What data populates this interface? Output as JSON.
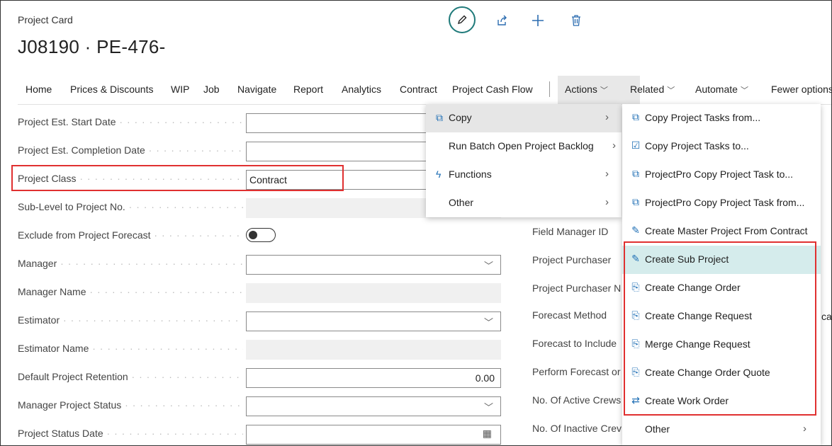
{
  "header": {
    "caption": "Project Card",
    "title": "J08190 · PE-476-"
  },
  "top_actions": [
    "edit-icon",
    "share-icon",
    "add-icon",
    "delete-icon"
  ],
  "nav": {
    "items": [
      "Home",
      "Prices & Discounts",
      "WIP",
      "Job",
      "Navigate",
      "Report",
      "Analytics",
      "Contract",
      "Project Cash Flow"
    ],
    "actions": "Actions",
    "related": "Related",
    "automate": "Automate",
    "fewer": "Fewer options"
  },
  "fields": [
    {
      "label": "Project Est. Start Date",
      "value": ""
    },
    {
      "label": "Project Est. Completion Date",
      "value": ""
    },
    {
      "label": "Project Class",
      "value": "Contract"
    },
    {
      "label": "Sub-Level to Project No.",
      "value": ""
    },
    {
      "label": "Exclude from Project Forecast",
      "value": ""
    },
    {
      "label": "Manager",
      "value": ""
    },
    {
      "label": "Manager Name",
      "value": ""
    },
    {
      "label": "Estimator",
      "value": ""
    },
    {
      "label": "Estimator Name",
      "value": ""
    },
    {
      "label": "Default Project Retention",
      "value": "0.00"
    },
    {
      "label": "Manager Project Status",
      "value": ""
    },
    {
      "label": "Project Status Date",
      "value": ""
    }
  ],
  "right_labels": [
    "Field Manager ID",
    "Project Purchaser",
    "Project Purchaser N",
    "Forecast Method",
    "Forecast to Include",
    "Perform Forecast or",
    "No. Of Active Crews",
    "No. Of Inactive Crev"
  ],
  "right_fragment": "cas",
  "actions_menu": [
    {
      "label": "Copy",
      "icon": "copy-icon"
    },
    {
      "label": "Run Batch Open Project Backlog",
      "icon": ""
    },
    {
      "label": "Functions",
      "icon": "lightning-icon"
    },
    {
      "label": "Other",
      "icon": ""
    }
  ],
  "copy_submenu": [
    {
      "label": "Copy Project Tasks from...",
      "icon": "copy-tasks-from-icon"
    },
    {
      "label": "Copy Project Tasks to...",
      "icon": "copy-tasks-to-icon"
    },
    {
      "label": "ProjectPro Copy Project Task to...",
      "icon": "copy-icon"
    },
    {
      "label": "ProjectPro Copy Project Task from...",
      "icon": "copy-icon"
    },
    {
      "label": "Create Master Project From Contract",
      "icon": "create-project-icon"
    },
    {
      "label": "Create Sub Project",
      "icon": "create-project-icon"
    },
    {
      "label": "Create Change Order",
      "icon": "change-order-icon"
    },
    {
      "label": "Create Change Request",
      "icon": "change-order-icon"
    },
    {
      "label": "Merge Change Request",
      "icon": "change-order-icon"
    },
    {
      "label": "Create Change Order Quote",
      "icon": "change-order-icon"
    },
    {
      "label": "Create Work Order",
      "icon": "work-order-icon"
    },
    {
      "label": "Other",
      "icon": ""
    }
  ],
  "colors": {
    "accent": "#1f7a7a",
    "highlight_box": "#e03030",
    "selected_item": "#d5ecec"
  }
}
